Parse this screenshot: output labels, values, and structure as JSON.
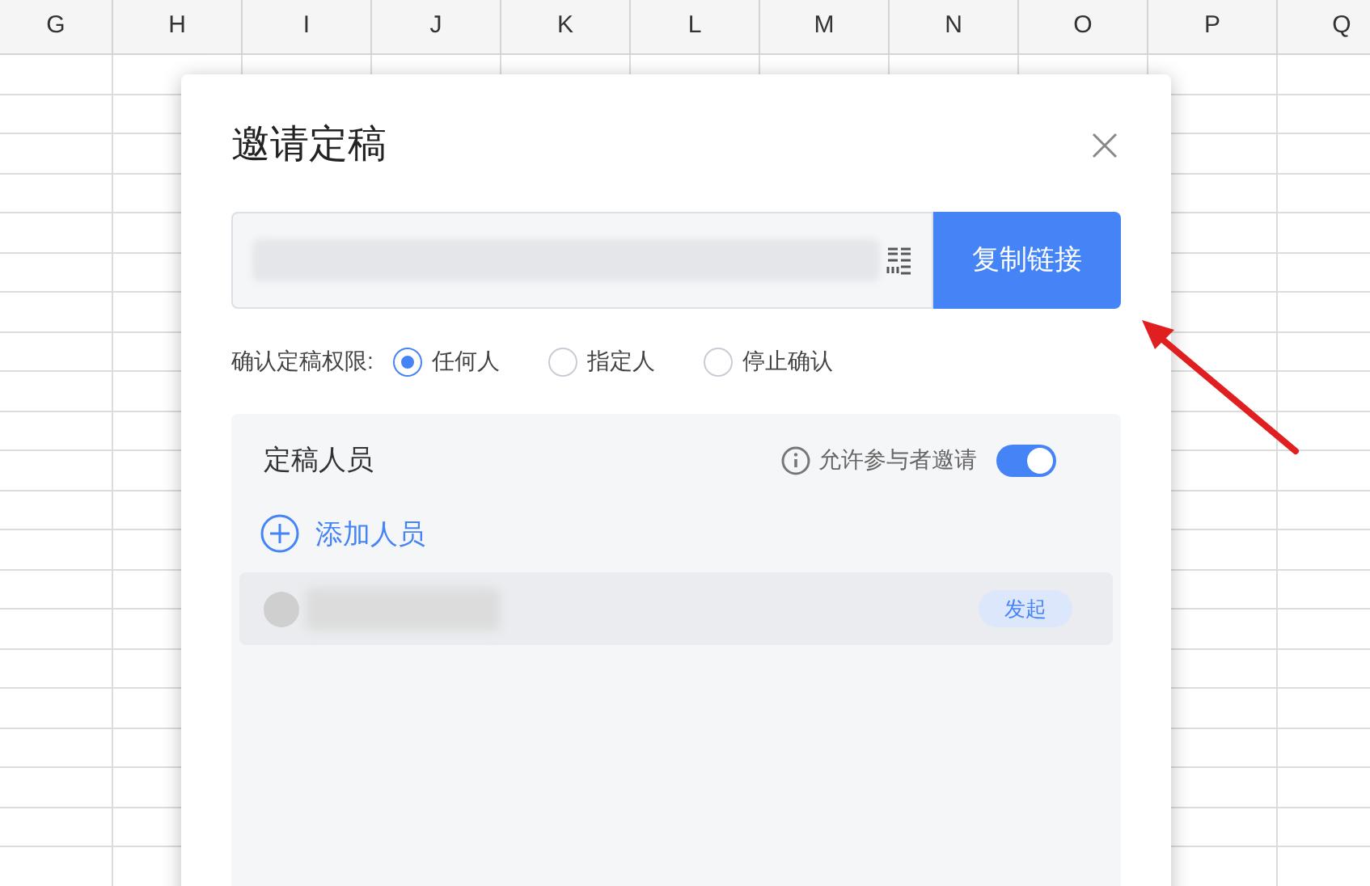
{
  "sheet": {
    "columns": [
      "G",
      "H",
      "I",
      "J",
      "K",
      "L",
      "M",
      "N",
      "O",
      "P",
      "Q"
    ]
  },
  "dialog": {
    "title": "邀请定稿",
    "copy_button": "复制链接",
    "permission": {
      "label": "确认定稿权限:",
      "options": [
        {
          "label": "任何人",
          "selected": true
        },
        {
          "label": "指定人",
          "selected": false
        },
        {
          "label": "停止确认",
          "selected": false
        }
      ]
    },
    "members": {
      "title": "定稿人员",
      "allow_invite": {
        "label": "允许参与者邀请",
        "on": true
      },
      "add_label": "添加人员",
      "rows": [
        {
          "badge": "发起"
        }
      ]
    }
  }
}
